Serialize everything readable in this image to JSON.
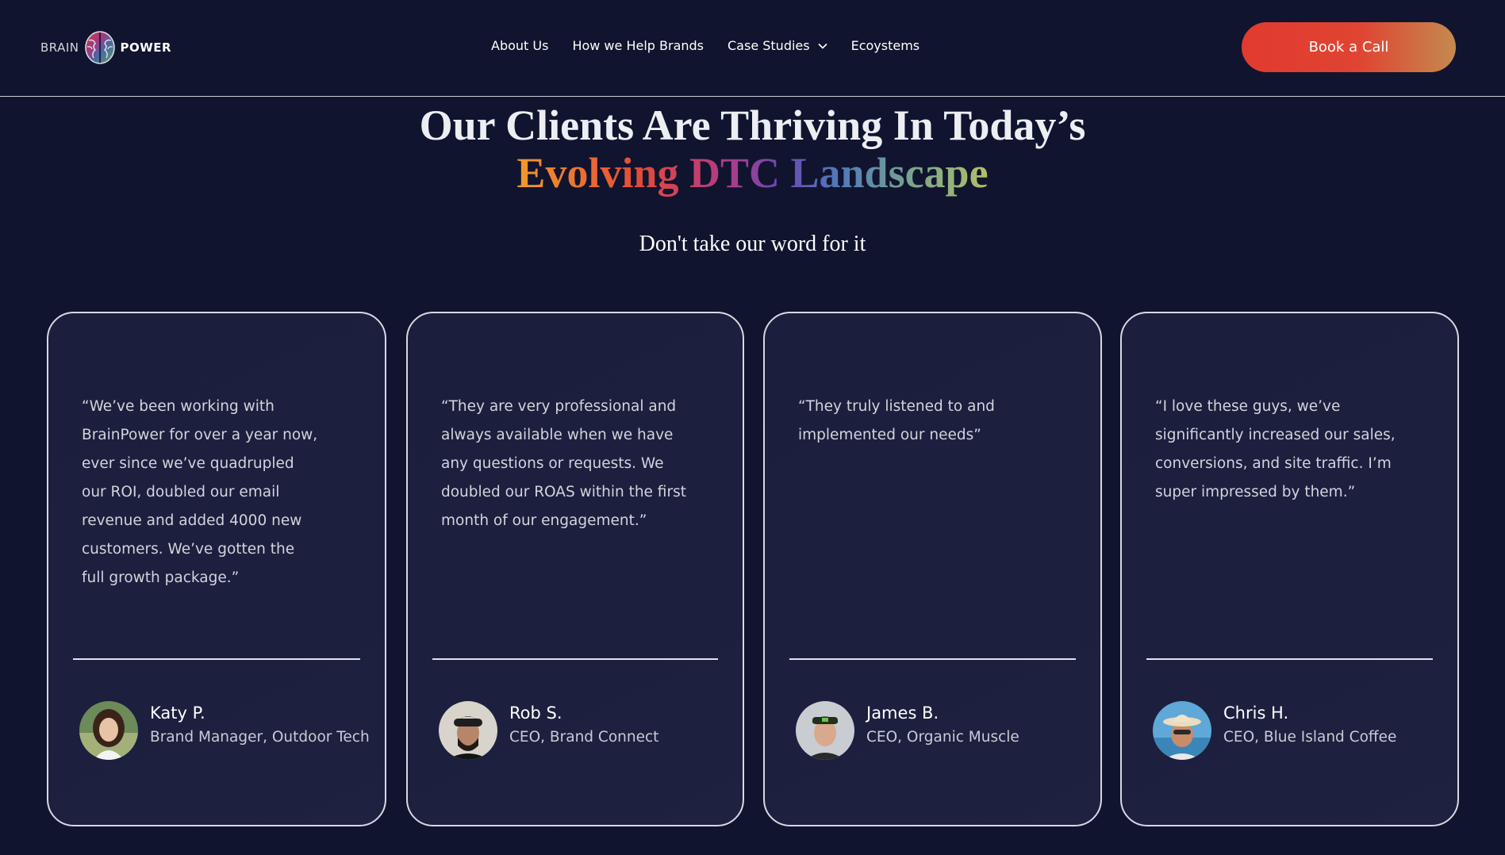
{
  "header": {
    "logo": {
      "word_left": "BRAIN",
      "word_right": "POWER",
      "icon": "brain-logo-icon"
    },
    "nav": [
      {
        "label": "About Us"
      },
      {
        "label": "How we Help Brands"
      },
      {
        "label": "Case Studies",
        "icon": "chevron-down-icon"
      },
      {
        "label": "Ecoystems"
      }
    ],
    "cta_label": "Book a Call"
  },
  "hero": {
    "line1": "Our Clients Are Thriving In Today’s",
    "line2": "Evolving DTC Landscape"
  },
  "subtitle": "Don't take our word for it",
  "testimonials": [
    {
      "quote": "“We’ve been working with BrainPower for over a year now, ever since we’ve quadrupled our ROI, doubled our email revenue and added 4000 new customers. We’ve gotten the full growth package.”",
      "name": "Katy P.",
      "role": "Brand Manager, Outdoor Tech"
    },
    {
      "quote": "“They are very professional and always available when we have any questions or requests. We doubled our ROAS within the first month of our engagement.”",
      "name": "Rob S.",
      "role": "CEO, Brand Connect"
    },
    {
      "quote": "“They truly listened to and implemented our needs”",
      "name": "James B.",
      "role": "CEO, Organic Muscle"
    },
    {
      "quote": "“I love these guys, we’ve significantly increased our sales, conversions, and site traffic. I’m super impressed by them.”",
      "name": "Chris H.",
      "role": "CEO, Blue Island Coffee"
    }
  ],
  "colors": {
    "background": "#10142e",
    "card_background": "#1c1f3e",
    "cta_start": "#e23a30",
    "cta_end": "#c48a4e",
    "gradient_orange": "#f29a2a",
    "gradient_red": "#e44a38",
    "gradient_purple": "#6a4ab0",
    "gradient_blue": "#4f78bb",
    "gradient_green": "#b2c066"
  }
}
